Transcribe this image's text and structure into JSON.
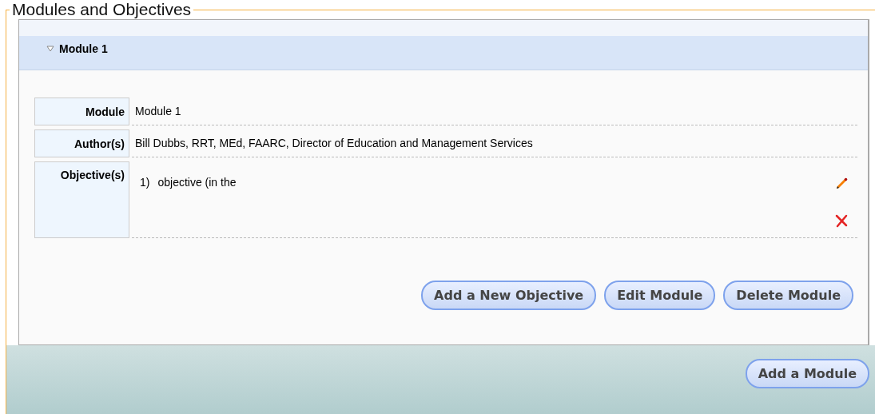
{
  "fieldset": {
    "legend": "Modules and Objectives"
  },
  "modules": [
    {
      "title": "Module 1",
      "expanded": true,
      "fields": [
        {
          "label": "Module",
          "value": "Module 1"
        },
        {
          "label": "Author(s)",
          "value": "Bill Dubbs, RRT, MEd, FAARC, Director of Education and Management Services"
        }
      ],
      "objectives_label": "Objective(s)",
      "objectives": [
        {
          "number": "1)",
          "text": "objective (in the"
        }
      ],
      "buttons": [
        "Add a New Objective",
        "Edit Module",
        "Delete Module"
      ]
    }
  ],
  "footer_buttons": [
    "Add a Module"
  ]
}
